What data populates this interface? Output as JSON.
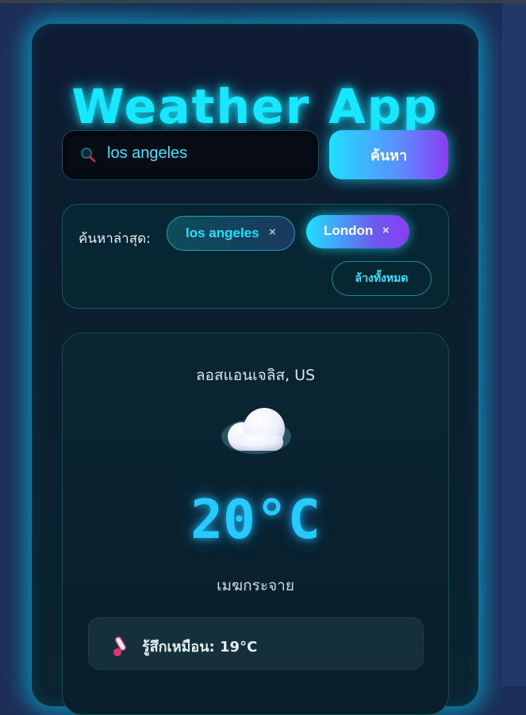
{
  "app": {
    "title": "Weather App"
  },
  "search": {
    "value": "los angeles",
    "button_label": "ค้นหา"
  },
  "recent": {
    "label": "ค้นหาล่าสุด:",
    "items": [
      {
        "label": "los angeles",
        "remove": "×"
      },
      {
        "label": "London",
        "remove": "×"
      }
    ],
    "clear_label": "ล้างทั้งหมด"
  },
  "weather": {
    "city": "ลอสแอนเจลิส, US",
    "icon": "cloud-icon",
    "temperature": "20°C",
    "description": "เมฆกระจาย",
    "feels_like": "รู้สึกเหมือน: 19°C",
    "feels_icon": "thermometer-icon"
  },
  "colors": {
    "accent": "#17e8ff",
    "gradient_end": "#8b3cf2"
  }
}
